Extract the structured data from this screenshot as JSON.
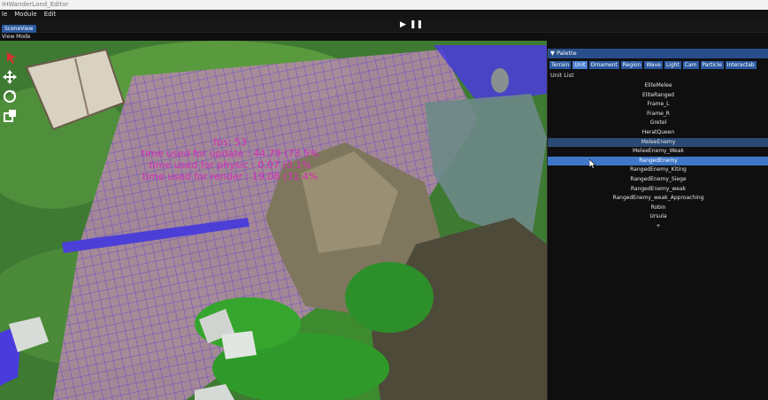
{
  "window": {
    "title": "IHWanderLand_Editor"
  },
  "menu": [
    "le",
    "Module",
    "Edit"
  ],
  "toolbar": {
    "play_icon": "play-icon",
    "pause_icon": "pause-icon"
  },
  "scene_tab": "SceneView",
  "view_mode": "View Mode",
  "stats": {
    "fps": "fps: 53",
    "update": "time used for update : 44.79 (73.5%",
    "physics": "time used for physic : 0.07 (0.1%",
    "render": "time used for render : 19.08 (31.4%"
  },
  "palette": {
    "title": "Palette",
    "tabs": [
      "Terrain",
      "Unit",
      "Ornament",
      "Region",
      "Wave",
      "Light",
      "Cam",
      "Particle",
      "Interactab"
    ],
    "active_tab": "Unit",
    "list_label": "Unit List",
    "units": [
      "EliteMelee",
      "EliteRanged",
      "Frame_L",
      "Frame_R",
      "Gretel",
      "HeratQueen",
      "MeleeEnemy",
      "MeleeEnemy_Weak",
      "RangedEnemy",
      "RangedEnemy_Kiting",
      "RangedEnemy_Siege",
      "RangedEnemy_weak",
      "RangedEnemy_weak_Approaching",
      "Robin",
      "Ursula",
      "+"
    ],
    "hovered_unit": "MeleeEnemy",
    "selected_unit": "RangedEnemy"
  },
  "colors": {
    "accent": "#2c5aa0",
    "selection": "#3e77c8",
    "stats_text": "#d52db9"
  }
}
